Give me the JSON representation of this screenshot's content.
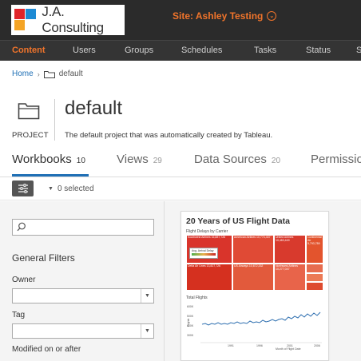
{
  "header": {
    "logo_text": "J.A. Consulting",
    "site_label": "Site: Ashley Testing",
    "site_chevron": "⌄"
  },
  "nav": {
    "items": [
      {
        "label": "Content",
        "active": true
      },
      {
        "label": "Users"
      },
      {
        "label": "Groups"
      },
      {
        "label": "Schedules"
      },
      {
        "label": "Tasks"
      },
      {
        "label": "Status"
      },
      {
        "label": "S"
      }
    ]
  },
  "breadcrumb": {
    "home": "Home",
    "separator": "›",
    "current": "default"
  },
  "project": {
    "title": "default",
    "type": "PROJECT",
    "description": "The default project that was automatically created by Tableau."
  },
  "tabs": [
    {
      "label": "Workbooks",
      "count": "10",
      "active": true
    },
    {
      "label": "Views",
      "count": "29"
    },
    {
      "label": "Data Sources",
      "count": "20"
    },
    {
      "label": "Permissio",
      "count": ""
    }
  ],
  "toolbar": {
    "selected_caret": "▼",
    "selected_text": "0 selected"
  },
  "filters": {
    "search_placeholder": "",
    "heading": "General Filters",
    "owner_label": "Owner",
    "owner_value": "",
    "tag_label": "Tag",
    "tag_value": "",
    "modified_label": "Modified on or after",
    "dropdown_arrow": "▼"
  },
  "workbook": {
    "title": "20 Years of US Flight Data",
    "subtitle_treemap": "Flight Delays by Carrier",
    "legend_label": "Avg. Arrival Delay",
    "treemap_cells": [
      {
        "label": "Southwest Airlines 16,887,726",
        "color": "#d9342b"
      },
      {
        "label": "American Airlines 10,774,437",
        "color": "#e04a35"
      },
      {
        "label": "United Airlines 10,483,449",
        "color": "#d83a2d"
      },
      {
        "label": "Continental Air 5,793,789",
        "color": "#e3542d"
      },
      {
        "label": "US Airways 10,672,332",
        "color": "#e25a3c"
      },
      {
        "label": "Northwest Airlines 10,277,047",
        "color": "#e8644a"
      },
      {
        "label": "Delta Air Lines 13,827,726",
        "color": "#d5301f"
      },
      {
        "label": "",
        "color": "#e76d4f"
      },
      {
        "label": "",
        "color": "#ec7a55"
      },
      {
        "label": "",
        "color": "#de4b2f"
      }
    ],
    "subtitle_line": "Total Flights",
    "y_axis_label": "Flights",
    "x_axis_label": "Month of Flight Date",
    "y_ticks": [
      "600K",
      "500K",
      "400K",
      "300K"
    ],
    "x_ticks": [
      "1991",
      "1996",
      "2001",
      "2006"
    ]
  },
  "colors": {
    "accent": "#f0742b",
    "link": "#1f6fb5",
    "header_bg": "#2b2b2b",
    "nav_bg": "#343434",
    "line_series": "#2e6fb0"
  },
  "icons": {
    "breadcrumb_folder": "folder-icon",
    "project": "folder-icon",
    "filter_toggle": "sliders-icon",
    "search": "search-icon"
  }
}
